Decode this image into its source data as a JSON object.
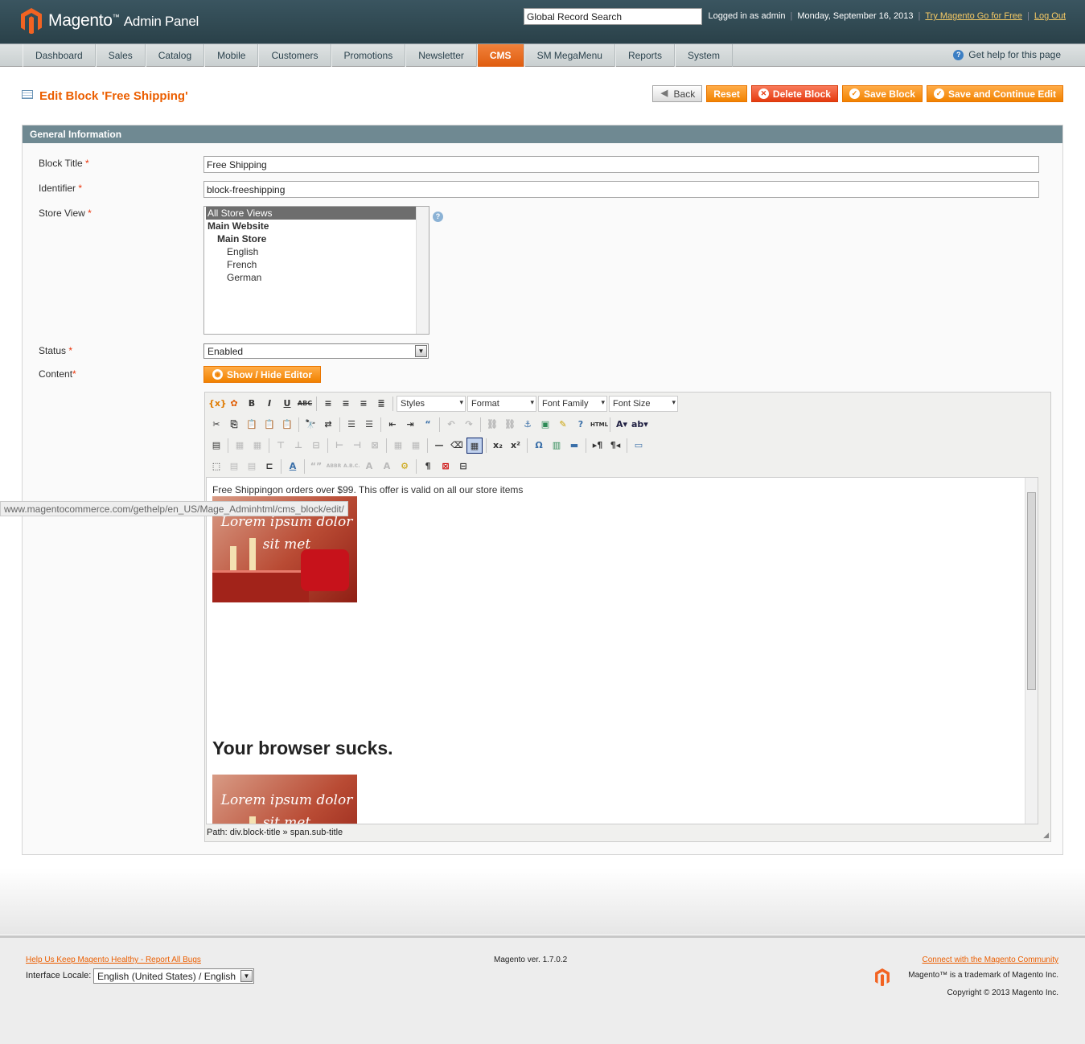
{
  "header": {
    "logo_text": "Magento",
    "logo_sub": "Admin Panel",
    "search_value": "Global Record Search",
    "logged_in": "Logged in as admin",
    "date": "Monday, September 16, 2013",
    "try_link": "Try Magento Go for Free",
    "logout_link": "Log Out"
  },
  "nav": {
    "items": [
      "Dashboard",
      "Sales",
      "Catalog",
      "Mobile",
      "Customers",
      "Promotions",
      "Newsletter",
      "CMS",
      "SM MegaMenu",
      "Reports",
      "System"
    ],
    "active": "CMS",
    "help": "Get help for this page"
  },
  "page": {
    "title": "Edit Block 'Free Shipping'",
    "buttons": {
      "back": "Back",
      "reset": "Reset",
      "delete": "Delete Block",
      "save": "Save Block",
      "save_continue": "Save and Continue Edit"
    }
  },
  "form": {
    "legend": "General Information",
    "labels": {
      "title": "Block Title",
      "identifier": "Identifier",
      "store_view": "Store View",
      "status": "Status",
      "content": "Content"
    },
    "required_mark": "*",
    "title_value": "Free Shipping",
    "identifier_value": "block-freeshipping",
    "store_views": [
      {
        "label": "All Store Views",
        "selected": true,
        "bold": false,
        "indent": 0
      },
      {
        "label": "Main Website",
        "selected": false,
        "bold": true,
        "indent": 0
      },
      {
        "label": "Main Store",
        "selected": false,
        "bold": true,
        "indent": 1
      },
      {
        "label": "English",
        "selected": false,
        "bold": false,
        "indent": 2
      },
      {
        "label": "French",
        "selected": false,
        "bold": false,
        "indent": 2
      },
      {
        "label": "German",
        "selected": false,
        "bold": false,
        "indent": 2
      }
    ],
    "status_value": "Enabled",
    "show_hide": "Show / Hide Editor"
  },
  "editor": {
    "selects": {
      "styles": "Styles",
      "format": "Format",
      "font_family": "Font Family",
      "font_size": "Font Size"
    },
    "content_text": "Free Shippingon orders over $99. This offer is valid on all our store items",
    "image_text_1": "Lorem ipsum dolor",
    "image_text_2": "sit met",
    "heading": "Your browser sucks.",
    "path": "Path: div.block-title » span.sub-title"
  },
  "tooltip": "www.magentocommerce.com/gethelp/en_US/Mage_Adminhtml/cms_block/edit/",
  "footer": {
    "report_link": "Help Us Keep Magento Healthy - Report All Bugs",
    "locale_label": "Interface Locale:",
    "locale_value": "English (United States) / English",
    "version": "Magento ver. 1.7.0.2",
    "community_link": "Connect with the Magento Community",
    "trademark": "Magento™ is a trademark of Magento Inc.",
    "copyright": "Copyright © 2013 Magento Inc."
  },
  "colors": {
    "accent": "#eb5e00",
    "header": "#2a4149",
    "legend": "#6f8992"
  }
}
